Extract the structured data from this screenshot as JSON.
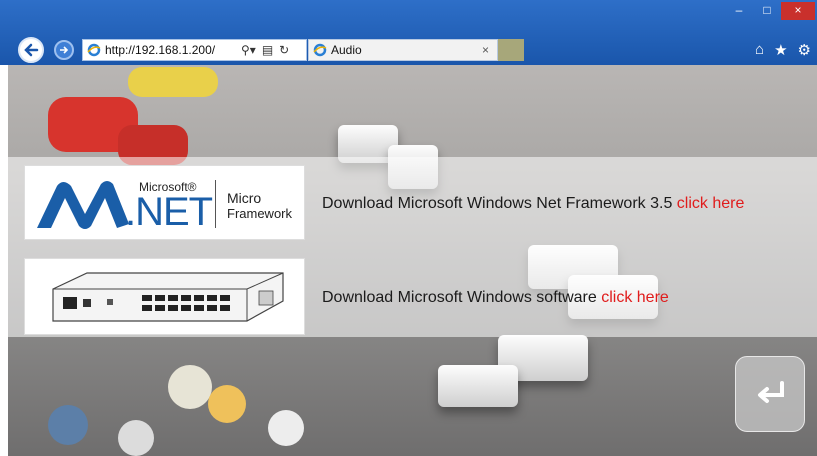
{
  "browser": {
    "address_url": "http://192.168.1.200/",
    "tab_title": "Audio",
    "tab_close": "×",
    "minimize": "–",
    "maximize": "□",
    "close": "×",
    "search_icon": "search-icon",
    "refresh_icon": "refresh-icon",
    "compat_icon": "compat-view-icon",
    "home_icon": "home-icon",
    "favorites_icon": "star-icon",
    "tools_icon": "gear-icon"
  },
  "downloads": [
    {
      "logo": {
        "brand": "Microsoft®",
        "product": ".NET",
        "sub1": "Micro",
        "sub2": "Framework"
      },
      "text": "Download Microsoft Windows Net Framework 3.5",
      "link": "click here"
    },
    {
      "logo": {
        "image": "network-switch-device"
      },
      "text": "Download Microsoft Windows software",
      "link": "click here"
    }
  ],
  "colors": {
    "link": "#e01c1c",
    "chrome": "#1e5fb8",
    "dotnet_blue": "#1a5ea8"
  },
  "enter_icon": "return-arrow-icon"
}
